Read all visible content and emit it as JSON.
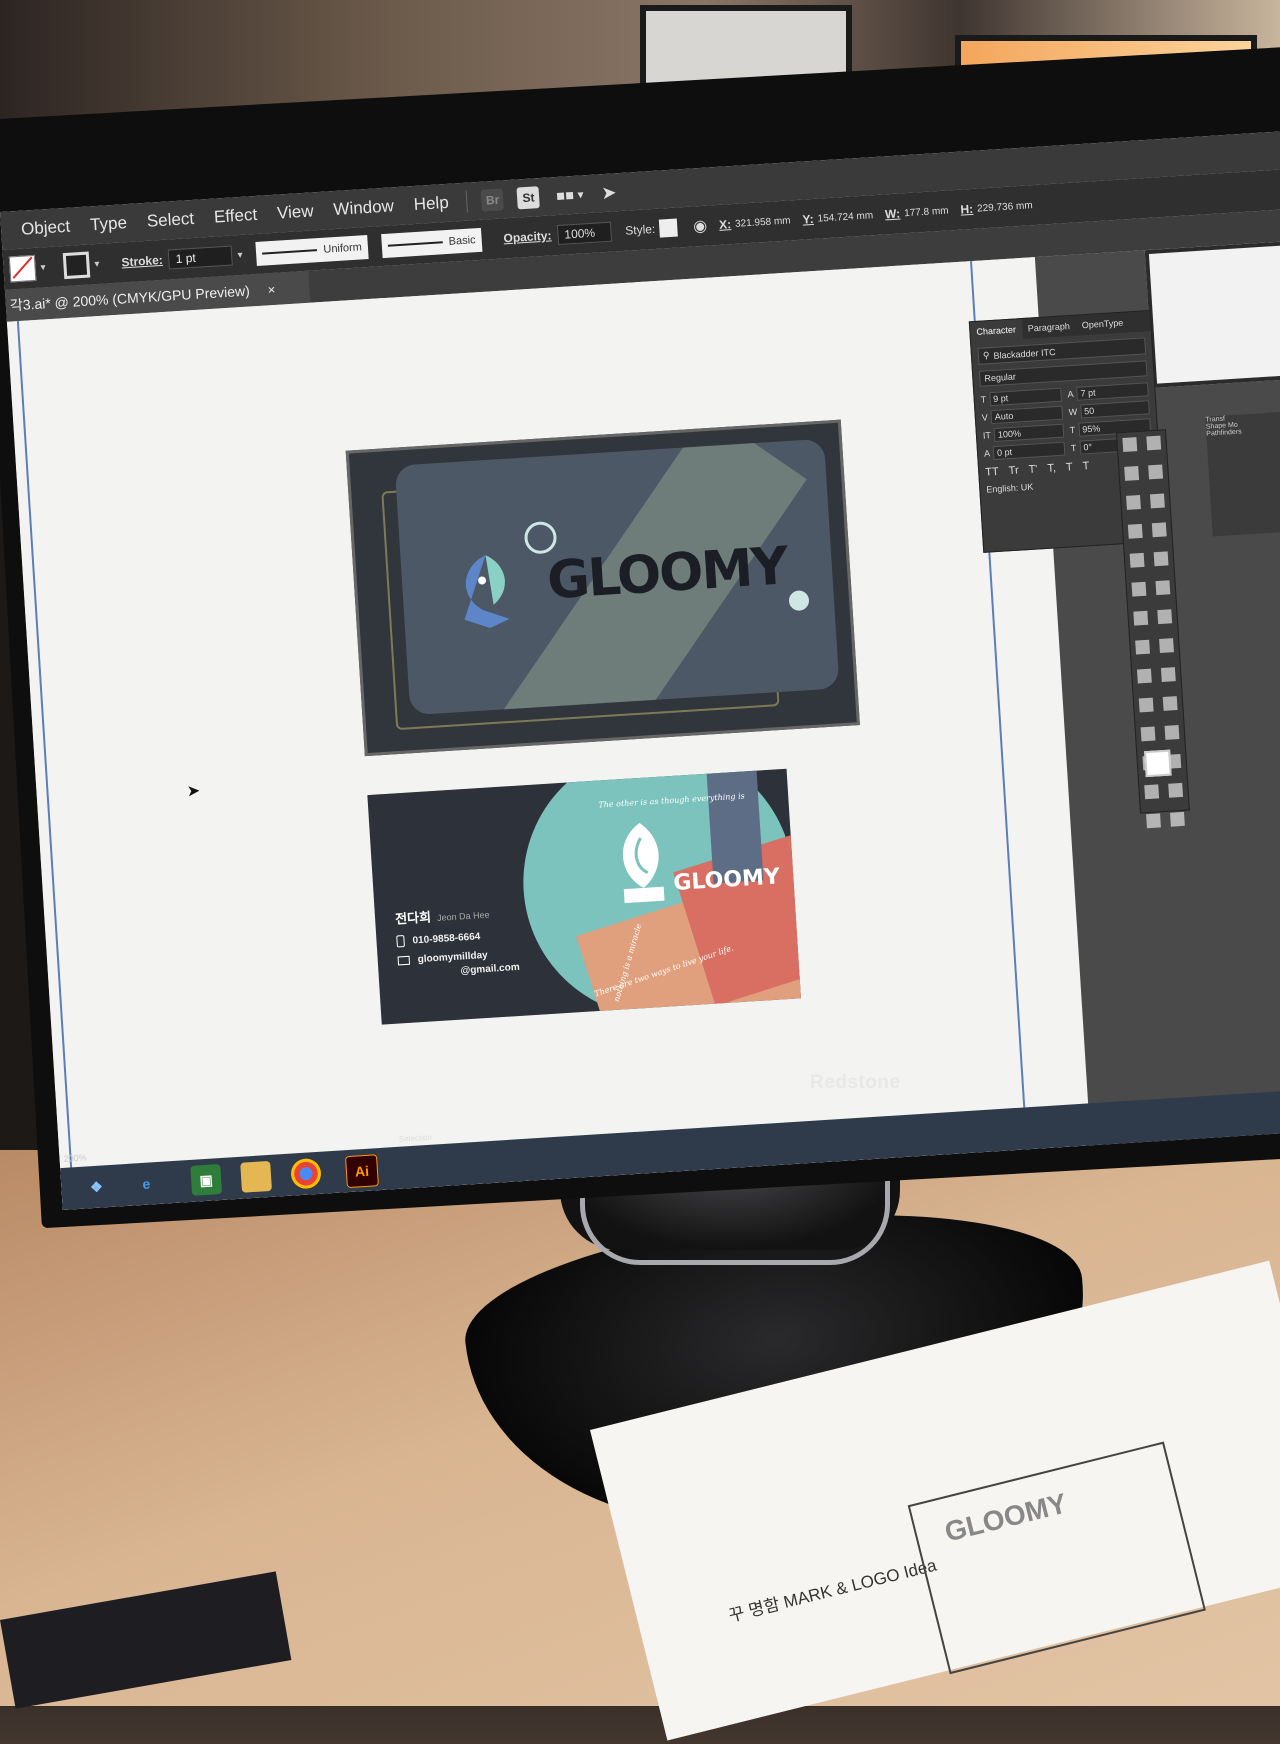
{
  "menubar": {
    "items": [
      "Object",
      "Type",
      "Select",
      "Effect",
      "View",
      "Window",
      "Help"
    ],
    "app_badges": {
      "bridge": "Br",
      "stock": "St"
    },
    "icons": {
      "workspace": "workspace-switcher-icon",
      "publish": "rocket-icon"
    }
  },
  "controlbar": {
    "stroke_label": "Stroke:",
    "stroke_value": "1 pt",
    "profile_uniform": "Uniform",
    "brush_basic": "Basic",
    "opacity_label": "Opacity:",
    "opacity_value": "100%",
    "style_label": "Style:",
    "x_label": "X:",
    "x_value": "321.958 mm",
    "y_label": "Y:",
    "y_value": "154.724 mm",
    "w_label": "W:",
    "w_value": "177.8 mm",
    "h_label": "H:",
    "h_value": "229.736 mm"
  },
  "document_tab": {
    "title": "각3.ai* @ 200% (CMYK/GPU Preview)",
    "close": "×"
  },
  "card_front": {
    "logo_text": "GLOOMY"
  },
  "card_back": {
    "name_ko": "전다희",
    "name_en": "Jeon Da Hee",
    "phone": "010-9858-6664",
    "email_line1": "gloomymillday",
    "email_line2": "@gmail.com",
    "logo_text": "GLOOMY",
    "quote_top": "The other is as though everything is",
    "quote_left": "nothing is a miracle",
    "quote_bottom": "There are two ways to live your life."
  },
  "character_panel": {
    "tabs": [
      "Character",
      "Paragraph",
      "OpenType"
    ],
    "font_family": "Blackadder ITC",
    "font_style": "Regular",
    "font_size": "9 pt",
    "leading": "7 pt",
    "kerning": "Auto",
    "tracking": "50",
    "vertical_scale": "100%",
    "horizontal_scale": "95%",
    "baseline_shift": "0 pt",
    "rotation": "0°",
    "glyph_buttons": [
      "TT",
      "Tr",
      "T'",
      "T,",
      "T",
      "T"
    ],
    "language": "English: UK"
  },
  "side_panel": {
    "title": "Transf",
    "shape_modes": "Shape Mo",
    "pathfinders": "Pathfinders"
  },
  "taskbar": {
    "zoom": "200%",
    "tooltip": "Selection",
    "illustrator_badge": "Ai"
  },
  "monitor": {
    "brand": "Redstone"
  },
  "paper": {
    "title": "꾸 명함   MARK & LOGO   Idea",
    "sketch": "GLOOMY"
  }
}
